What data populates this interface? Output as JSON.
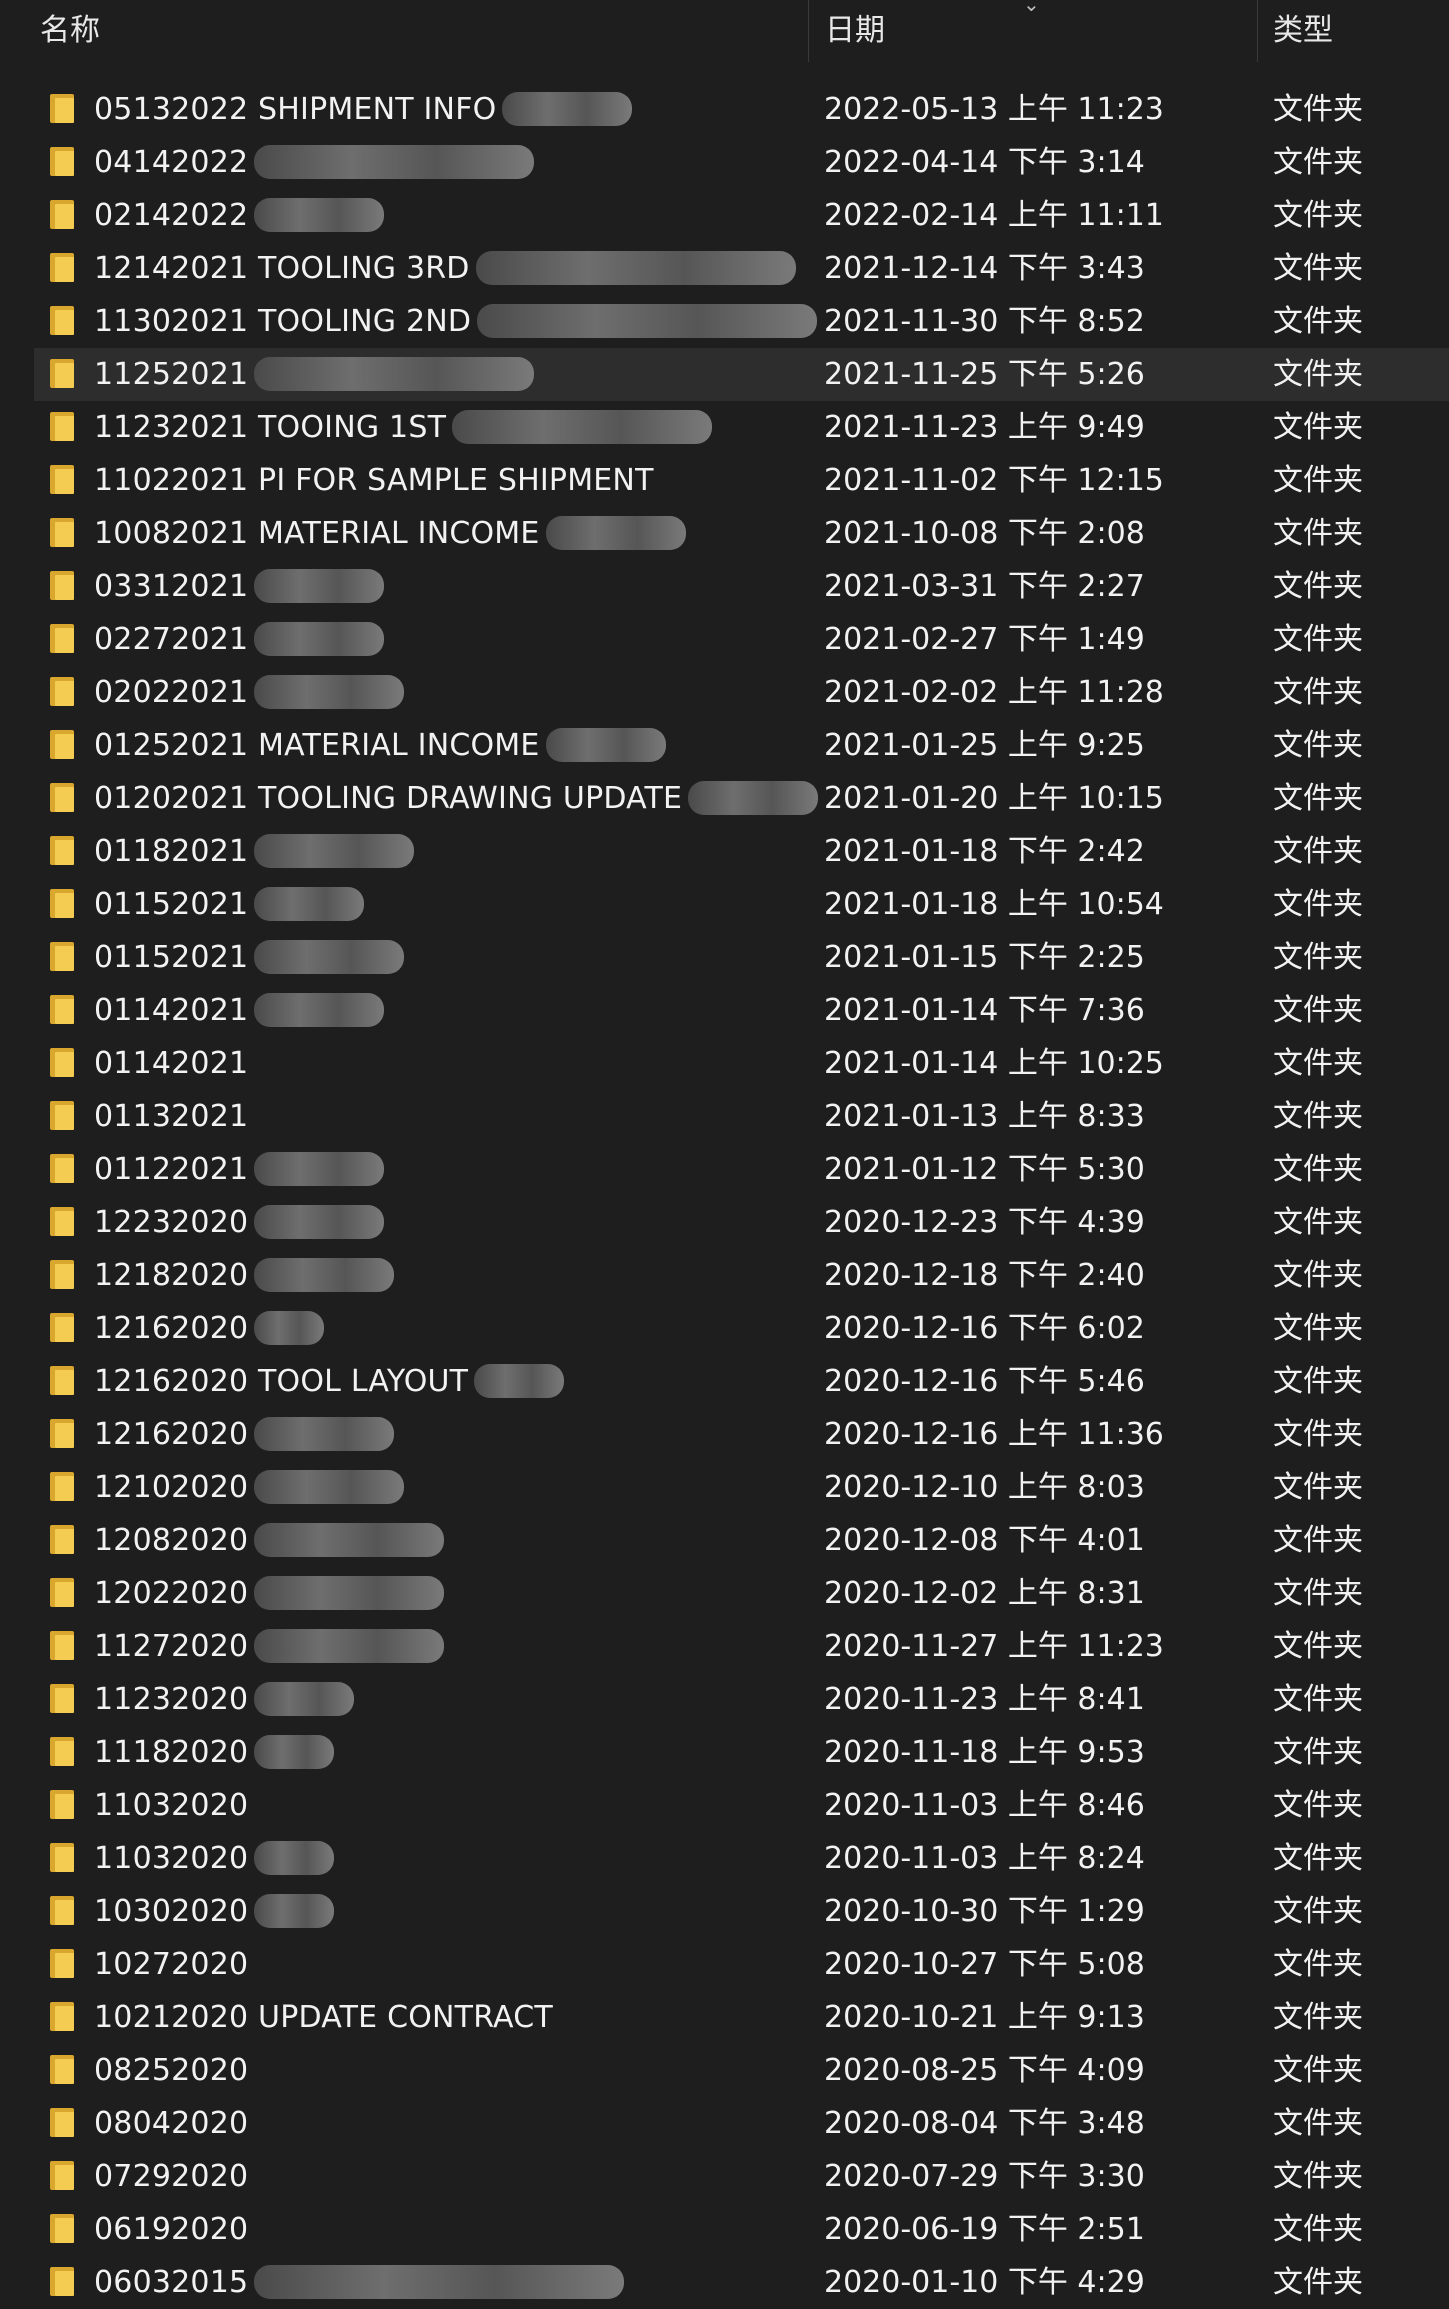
{
  "header": {
    "name_label": "名称",
    "date_label": "日期",
    "type_label": "类型"
  },
  "rows": [
    {
      "name": "05132022 SHIPMENT INFO",
      "date": "2022-05-13 上午 11:23",
      "type": "文件夹",
      "redacted": 130
    },
    {
      "name": "04142022",
      "date": "2022-04-14 下午 3:14",
      "type": "文件夹",
      "redacted": 280
    },
    {
      "name": "02142022",
      "date": "2022-02-14 上午 11:11",
      "type": "文件夹",
      "redacted": 130
    },
    {
      "name": "12142021 TOOLING 3RD",
      "date": "2021-12-14 下午 3:43",
      "type": "文件夹",
      "redacted": 320
    },
    {
      "name": "11302021 TOOLING 2ND",
      "date": "2021-11-30 下午 8:52",
      "type": "文件夹",
      "redacted": 340
    },
    {
      "name": "11252021",
      "date": "2021-11-25 下午 5:26",
      "type": "文件夹",
      "redacted": 280
    },
    {
      "name": "11232021 TOOING 1ST",
      "date": "2021-11-23 上午 9:49",
      "type": "文件夹",
      "redacted": 260
    },
    {
      "name": "11022021 PI FOR SAMPLE SHIPMENT",
      "date": "2021-11-02 下午 12:15",
      "type": "文件夹",
      "redacted": 0
    },
    {
      "name": "10082021 MATERIAL INCOME",
      "date": "2021-10-08 下午 2:08",
      "type": "文件夹",
      "redacted": 140
    },
    {
      "name": "03312021",
      "date": "2021-03-31 下午 2:27",
      "type": "文件夹",
      "redacted": 130
    },
    {
      "name": "02272021",
      "date": "2021-02-27 下午 1:49",
      "type": "文件夹",
      "redacted": 130
    },
    {
      "name": "02022021",
      "date": "2021-02-02 上午 11:28",
      "type": "文件夹",
      "redacted": 150
    },
    {
      "name": "01252021 MATERIAL INCOME",
      "date": "2021-01-25 上午 9:25",
      "type": "文件夹",
      "redacted": 120
    },
    {
      "name": "01202021 TOOLING DRAWING UPDATE",
      "date": "2021-01-20 上午 10:15",
      "type": "文件夹",
      "redacted": 130
    },
    {
      "name": "01182021",
      "date": "2021-01-18 下午 2:42",
      "type": "文件夹",
      "redacted": 160
    },
    {
      "name": "01152021",
      "date": "2021-01-18 上午 10:54",
      "type": "文件夹",
      "redacted": 110
    },
    {
      "name": "01152021",
      "date": "2021-01-15 下午 2:25",
      "type": "文件夹",
      "redacted": 150
    },
    {
      "name": "01142021",
      "date": "2021-01-14 下午 7:36",
      "type": "文件夹",
      "redacted": 130
    },
    {
      "name": "01142021",
      "date": "2021-01-14 上午 10:25",
      "type": "文件夹",
      "redacted": 0
    },
    {
      "name": "01132021",
      "date": "2021-01-13 上午 8:33",
      "type": "文件夹",
      "redacted": 0
    },
    {
      "name": "01122021",
      "date": "2021-01-12 下午 5:30",
      "type": "文件夹",
      "redacted": 130
    },
    {
      "name": "12232020",
      "date": "2020-12-23 下午 4:39",
      "type": "文件夹",
      "redacted": 130
    },
    {
      "name": "12182020",
      "date": "2020-12-18 下午 2:40",
      "type": "文件夹",
      "redacted": 140
    },
    {
      "name": "12162020",
      "date": "2020-12-16 下午 6:02",
      "type": "文件夹",
      "redacted": 70
    },
    {
      "name": "12162020   TOOL LAYOUT",
      "date": "2020-12-16 下午 5:46",
      "type": "文件夹",
      "redacted": 90
    },
    {
      "name": "12162020",
      "date": "2020-12-16 上午 11:36",
      "type": "文件夹",
      "redacted": 140
    },
    {
      "name": "12102020",
      "date": "2020-12-10 上午 8:03",
      "type": "文件夹",
      "redacted": 150
    },
    {
      "name": "12082020",
      "date": "2020-12-08 下午 4:01",
      "type": "文件夹",
      "redacted": 190
    },
    {
      "name": "12022020",
      "date": "2020-12-02 上午 8:31",
      "type": "文件夹",
      "redacted": 190
    },
    {
      "name": "11272020",
      "date": "2020-11-27 上午 11:23",
      "type": "文件夹",
      "redacted": 190
    },
    {
      "name": "11232020",
      "date": "2020-11-23 上午 8:41",
      "type": "文件夹",
      "redacted": 100
    },
    {
      "name": "11182020",
      "date": "2020-11-18 上午 9:53",
      "type": "文件夹",
      "redacted": 80
    },
    {
      "name": "11032020",
      "date": "2020-11-03 上午 8:46",
      "type": "文件夹",
      "redacted": 0
    },
    {
      "name": "11032020",
      "date": "2020-11-03 上午 8:24",
      "type": "文件夹",
      "redacted": 80
    },
    {
      "name": "10302020",
      "date": "2020-10-30 下午 1:29",
      "type": "文件夹",
      "redacted": 80
    },
    {
      "name": "10272020",
      "date": "2020-10-27 下午 5:08",
      "type": "文件夹",
      "redacted": 0
    },
    {
      "name": "10212020 UPDATE CONTRACT",
      "date": "2020-10-21 上午 9:13",
      "type": "文件夹",
      "redacted": 0
    },
    {
      "name": "08252020",
      "date": "2020-08-25 下午 4:09",
      "type": "文件夹",
      "redacted": 0
    },
    {
      "name": "08042020",
      "date": "2020-08-04 下午 3:48",
      "type": "文件夹",
      "redacted": 0
    },
    {
      "name": "07292020",
      "date": "2020-07-29 下午 3:30",
      "type": "文件夹",
      "redacted": 0
    },
    {
      "name": "06192020",
      "date": "2020-06-19 下午 2:51",
      "type": "文件夹",
      "redacted": 0
    },
    {
      "name": "06032015",
      "date": "2020-01-10 下午 4:29",
      "type": "文件夹",
      "redacted": 370
    }
  ],
  "selected_index": 5,
  "colors": {
    "background": "#1e1e1e",
    "selected_row": "#2d2d2d",
    "text": "#f2f2f2",
    "folder": "#f4cc52"
  },
  "icons": {
    "folder": "folder-icon",
    "sort": "chevron-down-icon"
  }
}
